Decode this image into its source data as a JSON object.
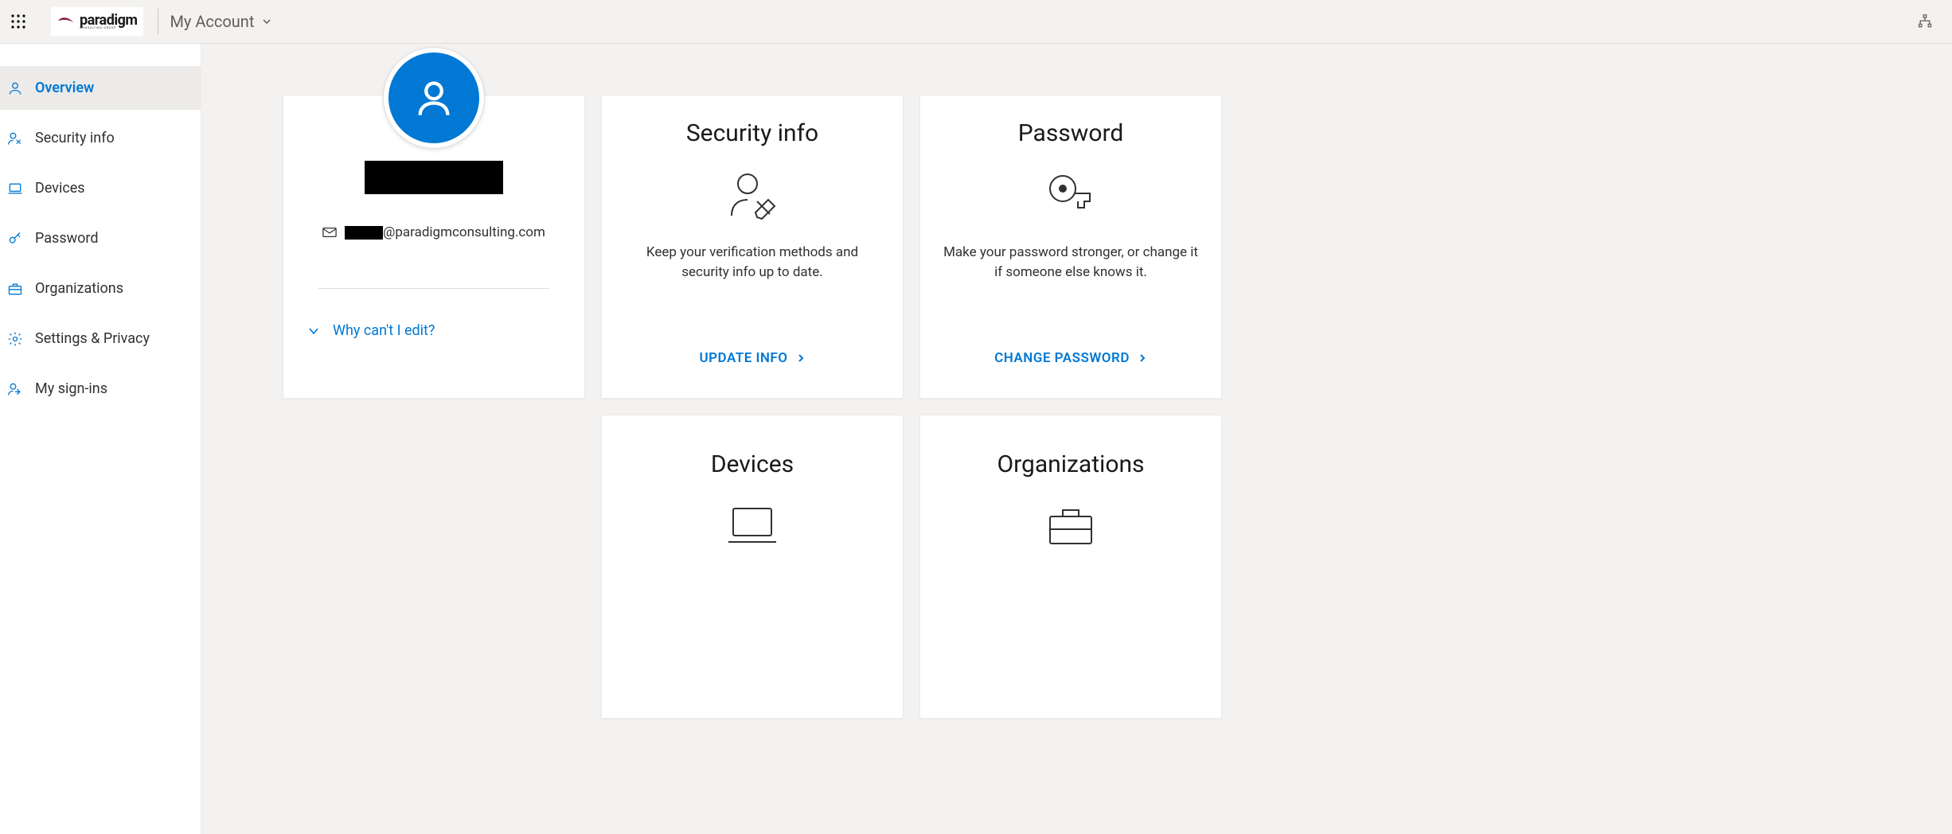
{
  "header": {
    "brand_name": "paradigm",
    "brand_sub": "CONSULTING GROUP",
    "title": "My Account"
  },
  "sidebar": {
    "items": [
      {
        "label": "Overview",
        "active": true
      },
      {
        "label": "Security info",
        "active": false
      },
      {
        "label": "Devices",
        "active": false
      },
      {
        "label": "Password",
        "active": false
      },
      {
        "label": "Organizations",
        "active": false
      },
      {
        "label": "Settings & Privacy",
        "active": false
      },
      {
        "label": "My sign-ins",
        "active": false
      }
    ]
  },
  "profile": {
    "name_redacted": true,
    "email_domain": "@paradigmconsulting.com",
    "why_edit_label": "Why can't I edit?"
  },
  "cards": {
    "security": {
      "title": "Security info",
      "desc": "Keep your verification methods and security info up to date.",
      "action": "UPDATE INFO"
    },
    "password": {
      "title": "Password",
      "desc": "Make your password stronger, or change it if someone else knows it.",
      "action": "CHANGE PASSWORD"
    },
    "devices": {
      "title": "Devices"
    },
    "organizations": {
      "title": "Organizations"
    }
  }
}
